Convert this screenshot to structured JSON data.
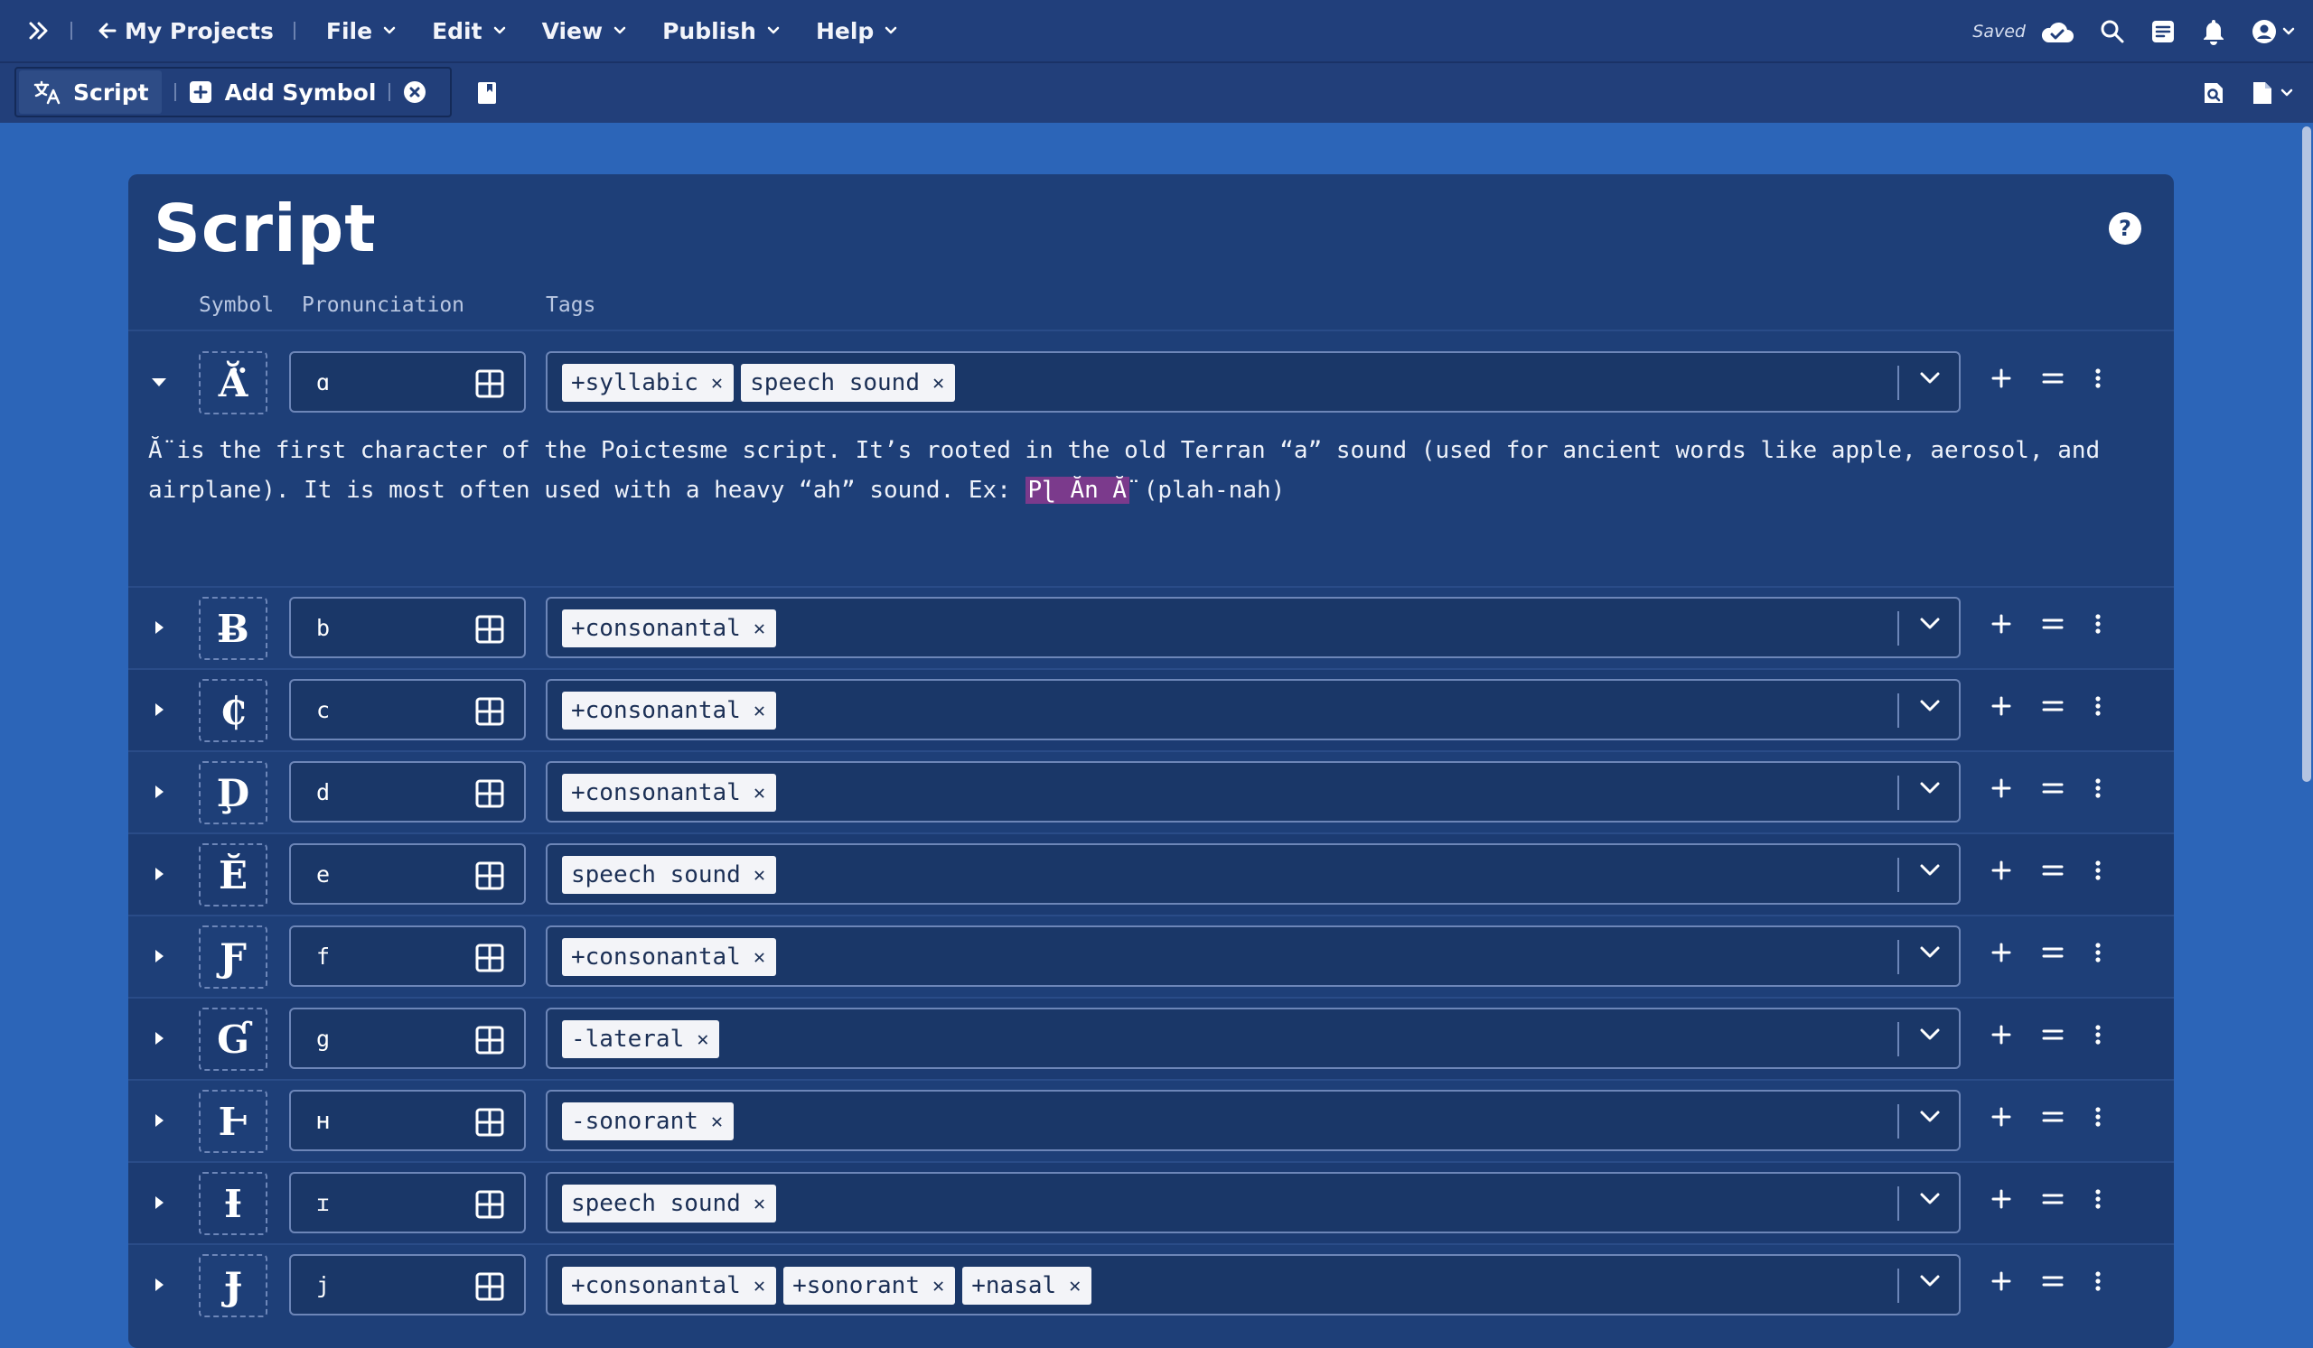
{
  "topbar": {
    "expand_icon": "double-chevron-right-icon",
    "back_label": "My Projects",
    "menus": [
      {
        "id": "file",
        "label": "File"
      },
      {
        "id": "edit",
        "label": "Edit"
      },
      {
        "id": "view",
        "label": "View"
      },
      {
        "id": "publish",
        "label": "Publish"
      },
      {
        "id": "help",
        "label": "Help"
      }
    ],
    "saved_label": "Saved"
  },
  "tabbar": {
    "script_tab": "Script",
    "add_symbol": "Add Symbol"
  },
  "panel": {
    "title": "Script",
    "help": "?",
    "columns": {
      "symbol": "Symbol",
      "pronunciation": "Pronunciation",
      "tags": "Tags"
    }
  },
  "rows": [
    {
      "symbol": "Ă̈",
      "pron": "ɑ",
      "tags": [
        "+syllabic",
        "speech sound"
      ]
    },
    {
      "symbol": "Ƀ",
      "pron": "b",
      "tags": [
        "+consonantal"
      ]
    },
    {
      "symbol": "₵",
      "pron": "c",
      "tags": [
        "+consonantal"
      ]
    },
    {
      "symbol": "Ḑ",
      "pron": "d",
      "tags": [
        "+consonantal"
      ]
    },
    {
      "symbol": "Ĕ",
      "pron": "e",
      "tags": [
        "speech sound"
      ]
    },
    {
      "symbol": "Ƒ",
      "pron": "f",
      "tags": [
        "+consonantal"
      ]
    },
    {
      "symbol": "Ɠ",
      "pron": "g",
      "tags": [
        "-lateral"
      ]
    },
    {
      "symbol": "Ⱶ",
      "pron": "ʜ",
      "tags": [
        "-sonorant"
      ]
    },
    {
      "symbol": "Ɨ",
      "pron": "ɪ",
      "tags": [
        "speech sound"
      ]
    },
    {
      "symbol": "Ɉ",
      "pron": "j",
      "tags": [
        "+consonantal",
        "+sonorant",
        "+nasal"
      ]
    }
  ],
  "description": {
    "part1": "Ă̈ is the first character of the Poictesme script. It’s rooted in the old Terran “a” sound (used for ancient words like apple, aerosol, and airplane). It is most often used with a heavy “ah” sound. Ex: ",
    "highlight": "Pɭ Ăn Ă̈",
    "part2": " (plah-nah)"
  },
  "colors": {
    "background": "#2c65b8",
    "topbar": "#213f7b",
    "panel": "#1e3f78",
    "tag_bg": "#f3f4f8",
    "highlight": "#7b3a8c"
  }
}
